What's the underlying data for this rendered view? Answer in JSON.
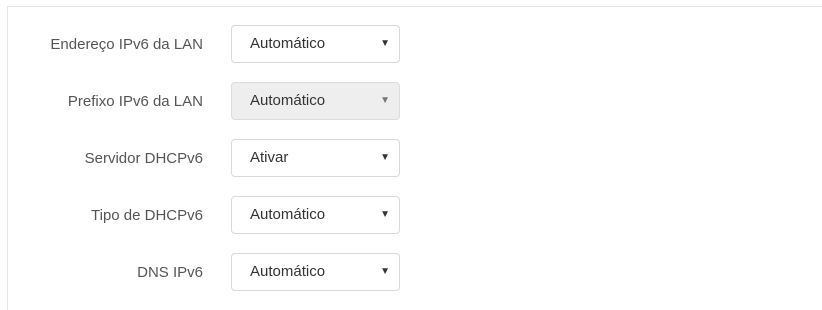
{
  "form": {
    "rows": [
      {
        "label": "Endereço IPv6 da LAN",
        "value": "Automático",
        "disabled": false
      },
      {
        "label": "Prefixo IPv6 da LAN",
        "value": "Automático",
        "disabled": true
      },
      {
        "label": "Servidor DHCPv6",
        "value": "Ativar",
        "disabled": false
      },
      {
        "label": "Tipo de DHCPv6",
        "value": "Automático",
        "disabled": false
      },
      {
        "label": "DNS IPv6",
        "value": "Automático",
        "disabled": false
      }
    ]
  },
  "icons": {
    "dropdown_arrow": "chevron-down-icon"
  }
}
